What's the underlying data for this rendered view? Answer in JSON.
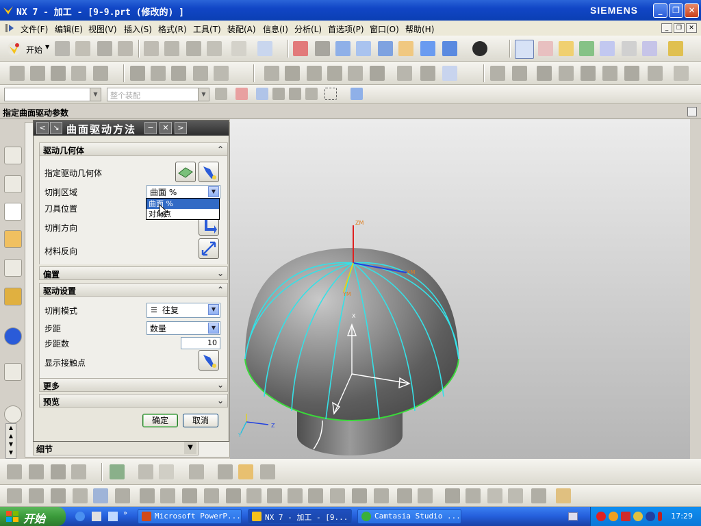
{
  "window": {
    "title": "NX 7 - 加工 - [9-9.prt  (修改的) ]",
    "brand": "SIEMENS",
    "minimize": "_",
    "restore": "❐",
    "close": "✕"
  },
  "menubar": {
    "items": [
      "文件(F)",
      "编辑(E)",
      "视图(V)",
      "插入(S)",
      "格式(R)",
      "工具(T)",
      "装配(A)",
      "信息(I)",
      "分析(L)",
      "首选项(P)",
      "窗口(O)",
      "帮助(H)"
    ]
  },
  "toolbar": {
    "start_label": "开始",
    "assembly_filter_placeholder": "整个装配"
  },
  "cue_line": "指定曲面驱动参数",
  "dialog": {
    "title": "曲面驱动方法",
    "nav_prev": "<",
    "nav_next": ">",
    "minimize": "−",
    "close": "✕",
    "sections": {
      "drive_geometry": {
        "header": "驱动几何体",
        "specify_label": "指定驱动几何体",
        "cut_area_label": "切削区域",
        "cut_area_value": "曲面 %",
        "tool_position_label": "刀具位置",
        "cut_direction_label": "切削方向",
        "material_reverse_label": "材料反向"
      },
      "offset": {
        "header": "偏置"
      },
      "drive_settings": {
        "header": "驱动设置",
        "cut_pattern_label": "切削模式",
        "cut_pattern_value": "往复",
        "stepover_label": "步距",
        "stepover_value": "数量",
        "step_count_label": "步距数",
        "step_count_value": "10",
        "show_contact_label": "显示接触点"
      },
      "more": {
        "header": "更多"
      },
      "preview": {
        "header": "预览"
      }
    },
    "dropdown_options": [
      "曲面 %",
      "对角点"
    ],
    "ok_label": "确定",
    "cancel_label": "取消"
  },
  "navigator": {
    "details_label": "细节"
  },
  "graphics": {
    "axis_labels": {
      "zm": "ZM",
      "xm": "XM",
      "ym": "YM",
      "x": "X",
      "z": "Z",
      "y": "Y"
    }
  },
  "taskbar": {
    "start_label": "开始",
    "tasks": [
      "Microsoft PowerP...",
      "NX 7 - 加工 - [9...",
      "Camtasia Studio ..."
    ],
    "clock": "17:29"
  },
  "colors": {
    "title_blue": "#1146c6",
    "dialog_title": "#3a3a3a",
    "cyan_curve": "#36e0e6",
    "green_edge": "#3ad83a",
    "highlight": "#316ac5"
  }
}
